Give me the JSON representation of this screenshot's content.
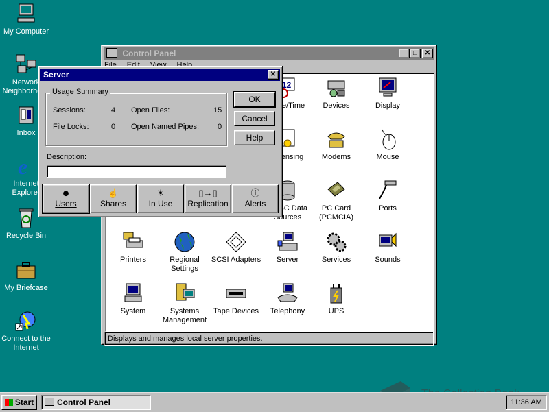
{
  "desktop": {
    "icons": [
      {
        "label": "My Computer"
      },
      {
        "label": "Network Neighborhood"
      },
      {
        "label": "Inbox"
      },
      {
        "label": "Internet Explorer"
      },
      {
        "label": "Recycle Bin"
      },
      {
        "label": "My Briefcase"
      },
      {
        "label": "Connect to the Internet"
      }
    ]
  },
  "control_panel": {
    "title": "Control Panel",
    "menu": [
      "File",
      "Edit",
      "View",
      "Help"
    ],
    "items": [
      {
        "label": "Date/Time",
        "icon": "datetime-icon"
      },
      {
        "label": "Devices",
        "icon": "devices-icon"
      },
      {
        "label": "Display",
        "icon": "display-icon"
      },
      {
        "label": "Licensing",
        "icon": "licensing-icon"
      },
      {
        "label": "Modems",
        "icon": "modems-icon"
      },
      {
        "label": "Mouse",
        "icon": "mouse-icon"
      },
      {
        "label": "ODBC Data Sources",
        "icon": "odbc-icon"
      },
      {
        "label": "PC Card (PCMCIA)",
        "icon": "pccard-icon"
      },
      {
        "label": "Ports",
        "icon": "ports-icon"
      },
      {
        "label": "Printers",
        "icon": "printers-icon"
      },
      {
        "label": "Regional Settings",
        "icon": "globe-icon"
      },
      {
        "label": "SCSI Adapters",
        "icon": "scsi-icon"
      },
      {
        "label": "Server",
        "icon": "server-icon"
      },
      {
        "label": "Services",
        "icon": "services-icon"
      },
      {
        "label": "Sounds",
        "icon": "sounds-icon"
      },
      {
        "label": "System",
        "icon": "system-icon"
      },
      {
        "label": "Systems Management",
        "icon": "systems-management-icon"
      },
      {
        "label": "Tape Devices",
        "icon": "tape-icon"
      },
      {
        "label": "Telephony",
        "icon": "telephony-icon"
      },
      {
        "label": "UPS",
        "icon": "ups-icon"
      }
    ],
    "status": "Displays and manages local server properties."
  },
  "server_dialog": {
    "title": "Server",
    "group_label": "Usage Summary",
    "sessions_label": "Sessions:",
    "sessions_value": "4",
    "open_files_label": "Open Files:",
    "open_files_value": "15",
    "file_locks_label": "File Locks:",
    "file_locks_value": "0",
    "open_pipes_label": "Open Named Pipes:",
    "open_pipes_value": "0",
    "ok_label": "OK",
    "cancel_label": "Cancel",
    "help_label": "Help",
    "description_label": "Description:",
    "description_value": "",
    "buttons": {
      "users": "Users",
      "shares": "Shares",
      "in_use": "In Use",
      "replication": "Replication",
      "alerts": "Alerts"
    }
  },
  "taskbar": {
    "start_label": "Start",
    "task_label": "Control Panel",
    "clock": "11:36 AM"
  },
  "watermark": "The Collection Book",
  "colors": {
    "desktop": "#008080",
    "active_title": "#000080",
    "inactive_title": "#808080",
    "face": "#c0c0c0"
  }
}
